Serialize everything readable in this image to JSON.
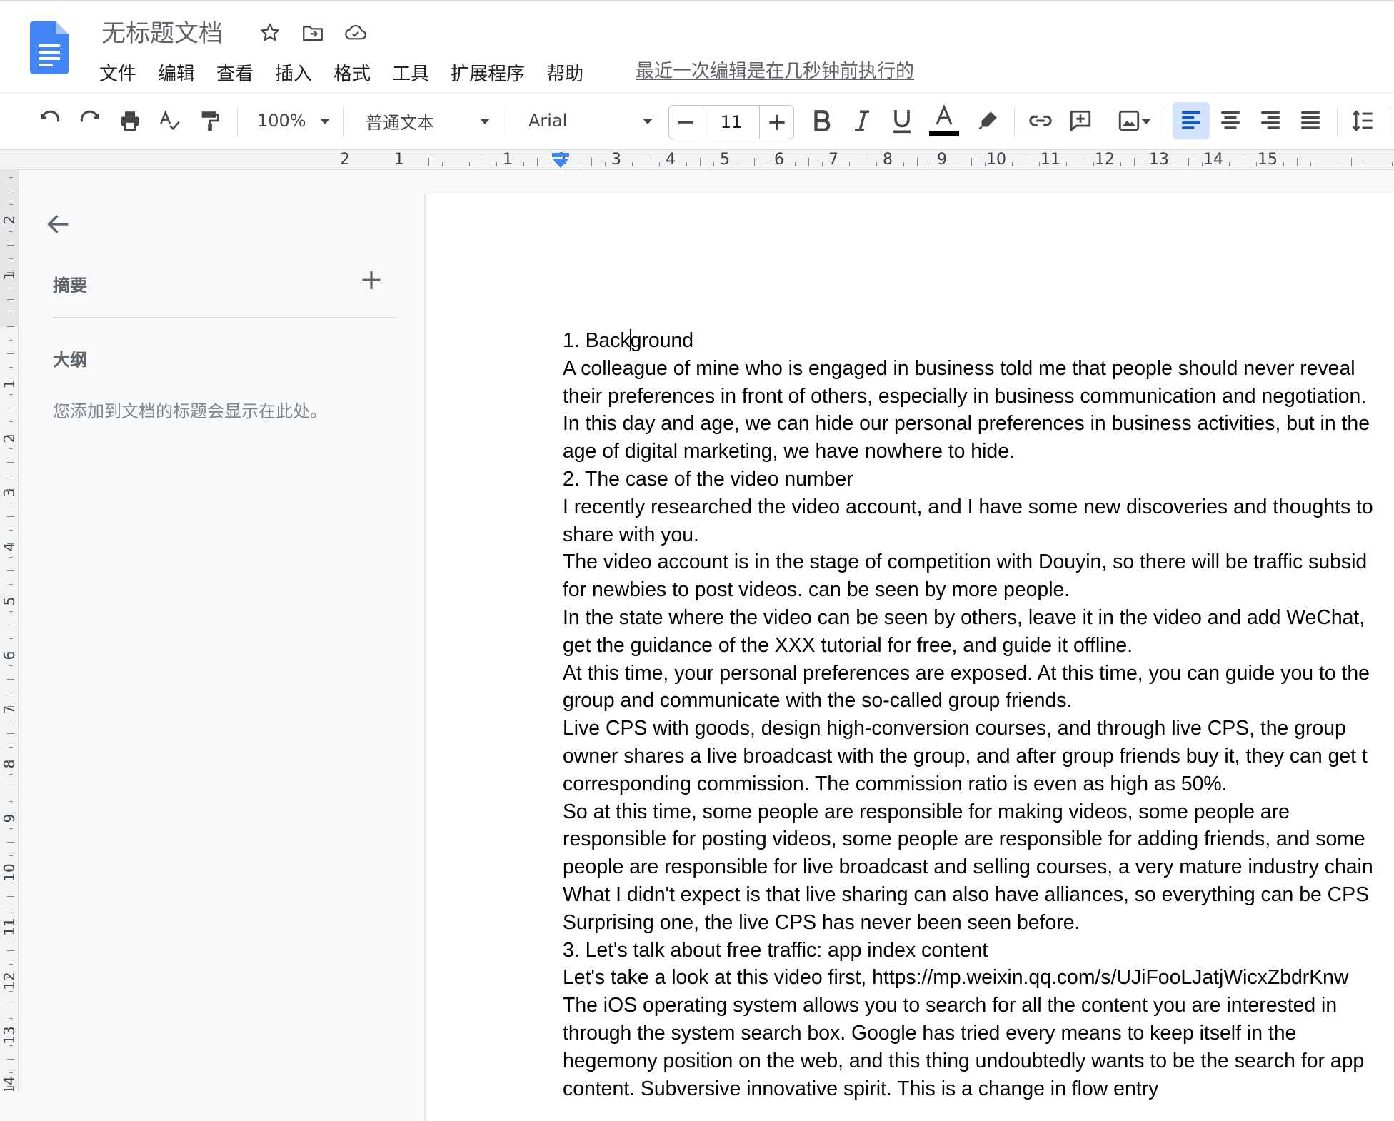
{
  "app": {
    "title": "无标题文档",
    "menu": [
      "文件",
      "编辑",
      "查看",
      "插入",
      "格式",
      "工具",
      "扩展程序",
      "帮助"
    ],
    "last_edit": "最近一次编辑是在几秒钟前执行的"
  },
  "toolbar": {
    "zoom": "100%",
    "style": "普通文本",
    "font": "Arial",
    "font_size": "11",
    "minus": "−",
    "plus": "+",
    "text_color": "#000000",
    "active_alignment": "align-left"
  },
  "ruler": {
    "horizontal": [
      "2",
      "1",
      "1",
      "2",
      "3",
      "4",
      "5",
      "6",
      "7",
      "8",
      "9",
      "10",
      "11",
      "12",
      "13",
      "14",
      "15"
    ],
    "vertical": [
      "2",
      "1",
      "1",
      "2",
      "3",
      "4",
      "5",
      "6",
      "7",
      "8",
      "9",
      "10",
      "11",
      "12",
      "13",
      "14"
    ]
  },
  "outline": {
    "summary_label": "摘要",
    "summary_add": "+",
    "outline_label": "大纲",
    "hint": "您添加到文档的标题会显示在此处。"
  },
  "document": {
    "heading_start": "1. Back",
    "heading_end": "ground",
    "lines": [
      "A colleague of mine who is engaged in business told me that people should never reveal",
      "their preferences in front of others, especially in business communication and negotiation.",
      "In this day and age, we can hide our personal preferences in business activities, but in the",
      "age of digital marketing, we have nowhere to hide.",
      "2. The case of the video number",
      "I recently researched the video account, and I have some new discoveries and thoughts to",
      "share with you.",
      "The video account is in the stage of competition with Douyin, so there will be traffic subsid",
      "for newbies to post videos. can be seen by more people.",
      "In the state where the video can be seen by others, leave it in the video and add WeChat,",
      "get the guidance of the XXX tutorial for free, and guide it offline.",
      "At this time, your personal preferences are exposed. At this time, you can guide you to the",
      "group and communicate with the so-called group friends.",
      "Live CPS with goods, design high-conversion courses, and through live CPS, the group",
      "owner shares a live broadcast with the group, and after group friends buy it, they can get t",
      "corresponding commission. The commission ratio is even as high as 50%.",
      "So at this time, some people are responsible for making videos, some people are",
      "responsible for posting videos, some people are responsible for adding friends, and some",
      "people are responsible for live broadcast and selling courses, a very mature industry chain",
      "What I didn't expect is that live sharing can also have alliances, so everything can be CPS",
      "Surprising one, the live CPS has never been seen before.",
      "3. Let's talk about free traffic: app index content",
      "Let's take a look at this video first, https://mp.weixin.qq.com/s/UJiFooLJatjWicxZbdrKnw",
      "The iOS operating system allows you to search for all the content you are interested in",
      "through the system search box. Google has tried every means to keep itself in the",
      "hegemony position on the web, and this thing undoubtedly wants to be the search for app",
      "content. Subversive innovative spirit. This is a change in flow entry"
    ]
  }
}
